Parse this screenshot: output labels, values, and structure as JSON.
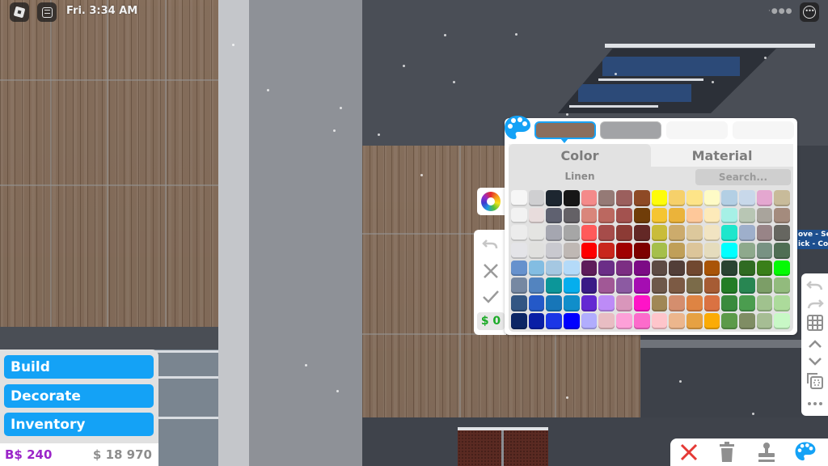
{
  "topbar": {
    "clock": "Fri. 3:34 AM",
    "status_dots": "·●●●"
  },
  "scene": {
    "sign_lines": [
      "ove - Sel",
      "ick - Cop"
    ]
  },
  "color_panel": {
    "tabs": [
      {
        "label": "Color",
        "active": true
      },
      {
        "label": "Material",
        "active": false
      }
    ],
    "selected_color_name": "Linen",
    "search_placeholder": "Search...",
    "search_value": "",
    "slots": [
      {
        "kind": "wood-texture",
        "color": "#8a6e5e",
        "selected": true
      },
      {
        "kind": "solid",
        "color": "#a2a3a6",
        "selected": false
      },
      {
        "kind": "empty",
        "color": "#f6f6f6",
        "selected": false
      },
      {
        "kind": "empty",
        "color": "#f6f6f6",
        "selected": false
      }
    ],
    "swatches": [
      [
        "#f6f6f6",
        "#cfcfd1",
        "#1d2630",
        "#171717",
        "#f48a8a",
        "#957a76",
        "#9b5f5d",
        "#8e4a26",
        "#fefc0a",
        "#f6d06a",
        "#fde488",
        "#fefbc6",
        "#b3cfe4",
        "#c8d8ea",
        "#e4a7d0",
        "#c8bb9a"
      ],
      [
        "#f2f2f2",
        "#e8dcdc",
        "#5f6170",
        "#646166",
        "#d9867b",
        "#bb6860",
        "#a3524f",
        "#703d09",
        "#f5c531",
        "#ebb33a",
        "#fec89a",
        "#fdeab9",
        "#a6f0e6",
        "#b8c6b4",
        "#a9a49c",
        "#a48b7d"
      ],
      [
        "#ececec",
        "#e4e4e2",
        "#a5a6b0",
        "#a6a6a6",
        "#ff5a5a",
        "#a64c4a",
        "#8c3b35",
        "#632826",
        "#c9bc3a",
        "#ccab6c",
        "#dcc89c",
        "#f1e4c2",
        "#1ee6cc",
        "#9eafcb",
        "#988487",
        "#666660"
      ],
      [
        "#e4e4e8",
        "#e0e0de",
        "#c9c9cf",
        "#bfb8b4",
        "#fe0000",
        "#c9261c",
        "#a00000",
        "#7d0000",
        "#a5bf4b",
        "#c09f58",
        "#dcc59a",
        "#e5dcbd",
        "#00ffff",
        "#8ea98c",
        "#789283",
        "#4f6e54"
      ],
      [
        "#6691cd",
        "#83bde2",
        "#a5c8e2",
        "#b4daf8",
        "#5e1c5a",
        "#6b2e87",
        "#7c2e83",
        "#7c0b85",
        "#5d4b44",
        "#523e38",
        "#714830",
        "#a95407",
        "#294432",
        "#306b22",
        "#3a7f19",
        "#04fa04"
      ],
      [
        "#7688a2",
        "#5384bf",
        "#0c9699",
        "#05aeed",
        "#3a1a86",
        "#a15896",
        "#8c5aa2",
        "#a50db2",
        "#6e584a",
        "#7c5a44",
        "#7b6b49",
        "#a65c34",
        "#237d26",
        "#288652",
        "#7c9e67",
        "#92bb7d"
      ],
      [
        "#335683",
        "#2459c8",
        "#1776b8",
        "#108eca",
        "#6429d2",
        "#bd8bf7",
        "#d996bb",
        "#fe14c7",
        "#a08756",
        "#d48e6e",
        "#de8443",
        "#da7242",
        "#3a8b3d",
        "#4b9d4f",
        "#a0c28e",
        "#acdb9b"
      ],
      [
        "#0c2665",
        "#0a1ea6",
        "#1b36e6",
        "#0000fe",
        "#b1adfd",
        "#e8bdc3",
        "#fda0d8",
        "#fc6bcb",
        "#fec5cb",
        "#ecb68d",
        "#e6a142",
        "#fbab06",
        "#5c9a4a",
        "#7f8d64",
        "#a6bd94",
        "#c8f8c6"
      ]
    ]
  },
  "mini_toolbar": {
    "cost": "$ 0",
    "buttons": [
      "color-wheel",
      "undo",
      "cancel",
      "confirm"
    ]
  },
  "right_toolbar": {
    "buttons": [
      "undo",
      "redo",
      "grid",
      "move-up",
      "move-down",
      "multi-select",
      "more"
    ]
  },
  "action_bar": {
    "buttons": [
      "close",
      "delete",
      "stamp",
      "paint"
    ],
    "close_color": "#e53935",
    "paint_color": "#14a2f6"
  },
  "build_menu": {
    "items": [
      "Build",
      "Decorate",
      "Inventory"
    ],
    "bucks": "B$ 240",
    "cash": "$ 18 970",
    "accent": "#14a2f6",
    "bucks_color": "#9b25c9"
  }
}
